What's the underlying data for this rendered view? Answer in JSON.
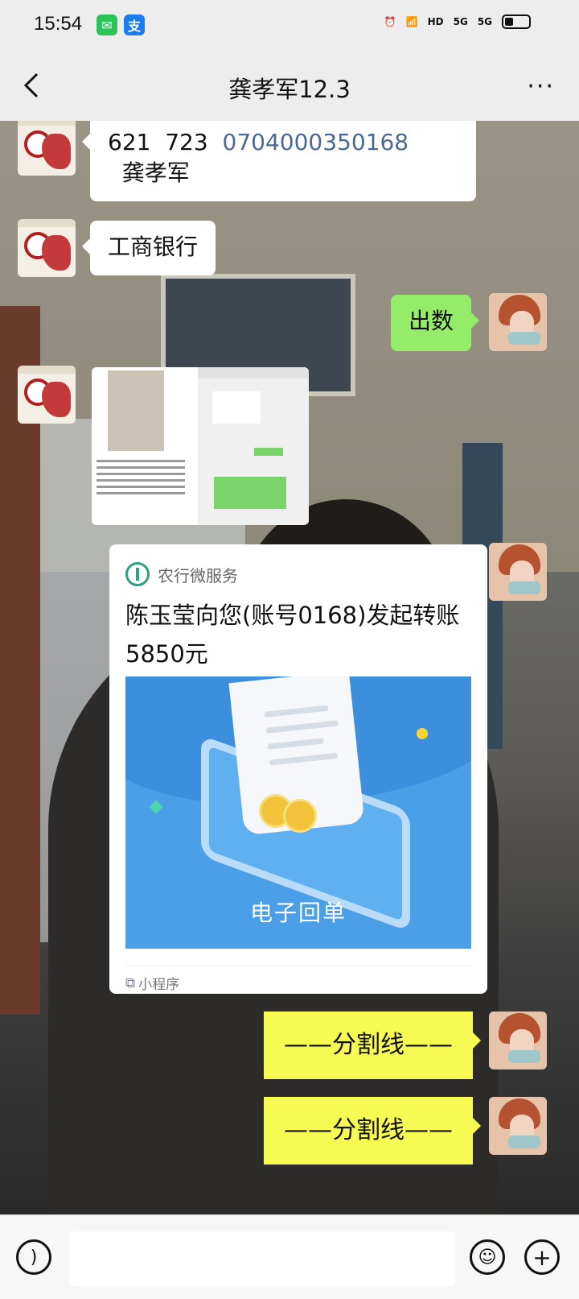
{
  "status_bar": {
    "time": "15:54",
    "apps": [
      {
        "icon": "wechat-icon",
        "color": "#2ac45a"
      },
      {
        "icon": "alipay-icon",
        "color": "#1a7cf0"
      }
    ],
    "indicators": [
      "alarm-icon",
      "wifi-icon",
      "HD",
      "5G",
      "5G",
      "battery-icon"
    ]
  },
  "header": {
    "title": "龚孝军12.3",
    "more": "···"
  },
  "messages": [
    {
      "side": "left",
      "text_prefix": "621  723  ",
      "account": "0704000350168",
      "text_suffix": "  龚孝军"
    },
    {
      "side": "left",
      "text": "工商银行"
    },
    {
      "side": "right",
      "text": "出数"
    },
    {
      "side": "left",
      "type": "image"
    },
    {
      "side": "right",
      "type": "mini-program-card",
      "brand": "农行微服务",
      "title": "陈玉莹向您(账号0168)发起转账5850元",
      "image_caption": "电子回单",
      "footer": "小程序"
    },
    {
      "side": "right",
      "text": "——分割线——"
    },
    {
      "side": "right",
      "text": "——分割线——"
    }
  ],
  "input_bar": {
    "placeholder": ""
  },
  "colors": {
    "bubble_green": "#95ec69",
    "bubble_yellow": "#f8fa54",
    "account_blue": "#4a6a93",
    "abc_green": "#2aa181"
  }
}
